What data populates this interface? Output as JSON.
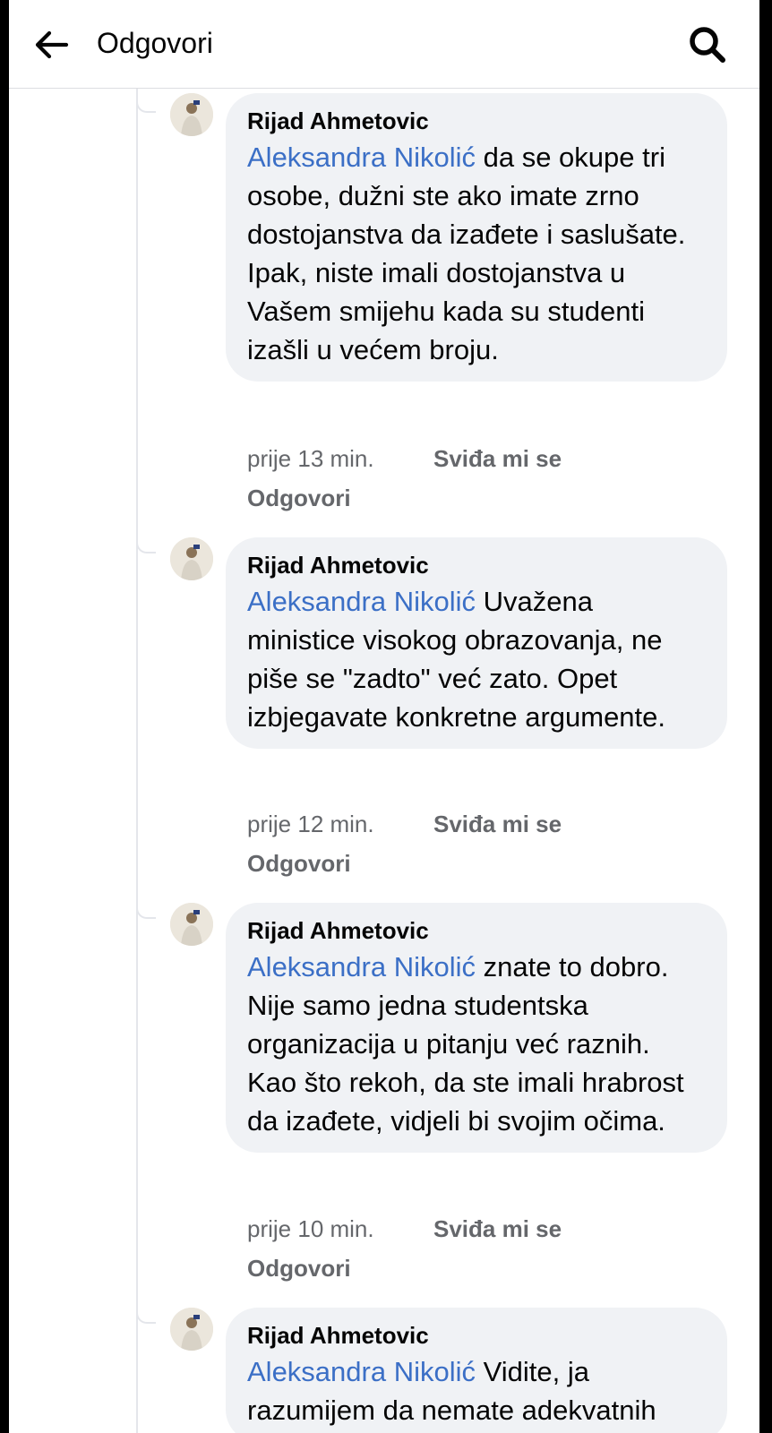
{
  "header": {
    "title": "Odgovori",
    "back_icon": "arrow-left-icon",
    "search_icon": "search-icon"
  },
  "comments": [
    {
      "author": "Rijad Ahmetovic",
      "mention": "Aleksandra Nikolić",
      "text": " da se okupe tri osobe, dužni ste ako imate zrno dostojanstva da izađete i saslušate. Ipak, niste imali dostojanstva u Vašem smijehu kada su studenti izašli u većem broju.",
      "time": "prije 13 min.",
      "like_label": "Sviđa mi se",
      "reply_label": "Odgovori"
    },
    {
      "author": "Rijad Ahmetovic",
      "mention": "Aleksandra Nikolić",
      "text": " Uvažena ministice visokog obrazovanja, ne piše se \"zadto\" već zato. Opet izbjegavate konkretne argumente.",
      "time": "prije 12 min.",
      "like_label": "Sviđa mi se",
      "reply_label": "Odgovori"
    },
    {
      "author": "Rijad Ahmetovic",
      "mention": "Aleksandra Nikolić",
      "text": " znate to dobro. Nije samo jedna studentska organizacija u pitanju već raznih. Kao što rekoh, da ste imali hrabrost da izađete, vidjeli bi svojim očima.",
      "time": "prije 10 min.",
      "like_label": "Sviđa mi se",
      "reply_label": "Odgovori"
    },
    {
      "author": "Rijad Ahmetovic",
      "mention": "Aleksandra Nikolić",
      "text": " Vidite, ja razumijem da nemate adekvatnih",
      "time": "",
      "like_label": "",
      "reply_label": ""
    }
  ],
  "colors": {
    "mention": "#3b6fc6",
    "bubble": "#f0f2f5",
    "meta": "#65676b"
  }
}
